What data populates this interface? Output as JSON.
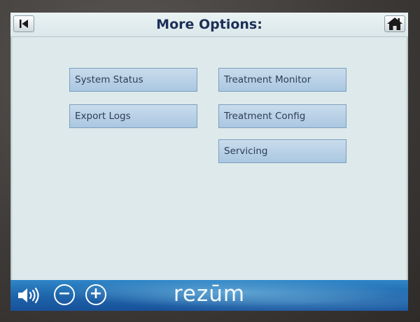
{
  "header": {
    "title": "More Options:",
    "back_icon": "back-arrow-icon",
    "home_icon": "home-icon"
  },
  "options": {
    "left": [
      {
        "label": "System Status"
      },
      {
        "label": "Export Logs"
      }
    ],
    "right": [
      {
        "label": "Treatment Monitor"
      },
      {
        "label": "Treatment Config"
      },
      {
        "label": "Servicing"
      }
    ]
  },
  "footer": {
    "volume_icon": "speaker-volume-icon",
    "decrease_label": "−",
    "increase_label": "+",
    "brand": "rezūm"
  },
  "colors": {
    "screen_bg": "#dde9ea",
    "title": "#1d2f57",
    "button_fill": "#b8d1e7",
    "button_border": "#7e9fbd",
    "footer_blue": "#1e63a9"
  }
}
